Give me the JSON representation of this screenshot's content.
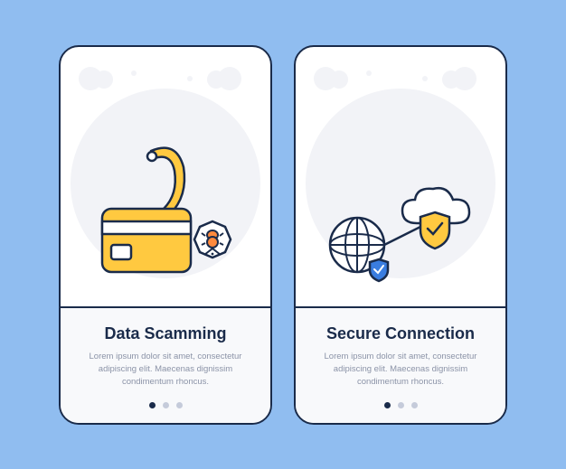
{
  "cards": [
    {
      "title": "Data Scamming",
      "description": "Lorem ipsum dolor sit amet, consectetur adipiscing elit. Maecenas dignissim condimentum rhoncus.",
      "illustration": "phishing-card-bug",
      "activeDot": 0
    },
    {
      "title": "Secure Connection",
      "description": "Lorem ipsum dolor sit amet, consectetur adipiscing elit. Maecenas dignissim condimentum rhoncus.",
      "illustration": "globe-cloud-shield",
      "activeDot": 0
    }
  ],
  "colors": {
    "background": "#90bdf0",
    "cardBorder": "#1a2b4a",
    "accentYellow": "#ffc940",
    "accentBlue": "#3a7de0",
    "accentOrange": "#ff8a3d",
    "muted": "#f2f3f7"
  }
}
